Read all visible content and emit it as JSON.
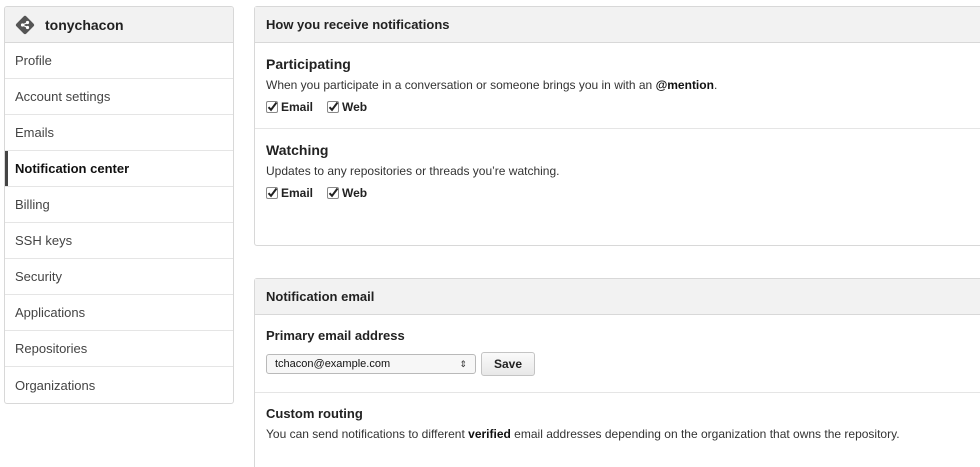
{
  "sidebar": {
    "username": "tonychacon",
    "items": [
      {
        "label": "Profile",
        "active": false
      },
      {
        "label": "Account settings",
        "active": false
      },
      {
        "label": "Emails",
        "active": false
      },
      {
        "label": "Notification center",
        "active": true
      },
      {
        "label": "Billing",
        "active": false
      },
      {
        "label": "SSH keys",
        "active": false
      },
      {
        "label": "Security",
        "active": false
      },
      {
        "label": "Applications",
        "active": false
      },
      {
        "label": "Repositories",
        "active": false
      },
      {
        "label": "Organizations",
        "active": false
      }
    ]
  },
  "notifications": {
    "header": "How you receive notifications",
    "participating": {
      "title": "Participating",
      "desc_prefix": "When you participate in a conversation or someone brings you in with an ",
      "desc_bold": "@mention",
      "desc_suffix": ".",
      "email_label": "Email",
      "web_label": "Web",
      "email_checked": true,
      "web_checked": true
    },
    "watching": {
      "title": "Watching",
      "desc": "Updates to any repositories or threads you’re watching.",
      "email_label": "Email",
      "web_label": "Web",
      "email_checked": true,
      "web_checked": true
    }
  },
  "notification_email": {
    "header": "Notification email",
    "primary_label": "Primary email address",
    "selected_email": "tchacon@example.com",
    "save_label": "Save",
    "custom_routing_title": "Custom routing",
    "routing_prefix": "You can send notifications to different ",
    "routing_bold": "verified",
    "routing_suffix": " email addresses depending on the organization that owns the repository."
  },
  "icons": {
    "avatar": "git-diamond-icon",
    "checkbox": "checkmark-icon",
    "select": "up-down-arrow-icon"
  }
}
